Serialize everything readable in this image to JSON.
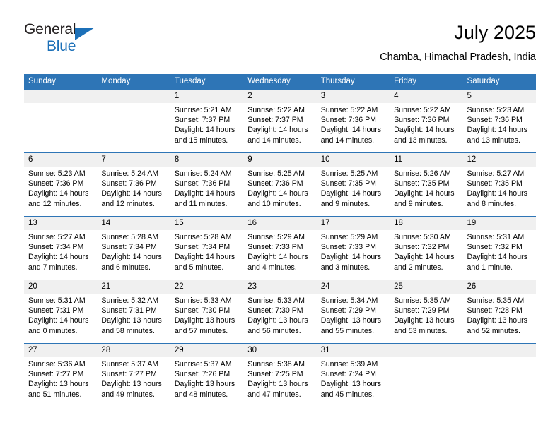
{
  "brand": {
    "name_top": "General",
    "name_bottom": "Blue",
    "accent_color": "#1c70b8"
  },
  "header": {
    "title": "July 2025",
    "location": "Chamba, Himachal Pradesh, India"
  },
  "theme": {
    "header_bg": "#2e75b6",
    "daynum_bg": "#f0f0f0",
    "cell_bg": "#ffffff",
    "text": "#000000"
  },
  "calendar": {
    "weekday_headers": [
      "Sunday",
      "Monday",
      "Tuesday",
      "Wednesday",
      "Thursday",
      "Friday",
      "Saturday"
    ],
    "weeks": [
      [
        {
          "day": "",
          "sunrise": "",
          "sunset": "",
          "daylight": "",
          "daylight2": ""
        },
        {
          "day": "",
          "sunrise": "",
          "sunset": "",
          "daylight": "",
          "daylight2": ""
        },
        {
          "day": "1",
          "sunrise": "Sunrise: 5:21 AM",
          "sunset": "Sunset: 7:37 PM",
          "daylight": "Daylight: 14 hours",
          "daylight2": "and 15 minutes."
        },
        {
          "day": "2",
          "sunrise": "Sunrise: 5:22 AM",
          "sunset": "Sunset: 7:37 PM",
          "daylight": "Daylight: 14 hours",
          "daylight2": "and 14 minutes."
        },
        {
          "day": "3",
          "sunrise": "Sunrise: 5:22 AM",
          "sunset": "Sunset: 7:36 PM",
          "daylight": "Daylight: 14 hours",
          "daylight2": "and 14 minutes."
        },
        {
          "day": "4",
          "sunrise": "Sunrise: 5:22 AM",
          "sunset": "Sunset: 7:36 PM",
          "daylight": "Daylight: 14 hours",
          "daylight2": "and 13 minutes."
        },
        {
          "day": "5",
          "sunrise": "Sunrise: 5:23 AM",
          "sunset": "Sunset: 7:36 PM",
          "daylight": "Daylight: 14 hours",
          "daylight2": "and 13 minutes."
        }
      ],
      [
        {
          "day": "6",
          "sunrise": "Sunrise: 5:23 AM",
          "sunset": "Sunset: 7:36 PM",
          "daylight": "Daylight: 14 hours",
          "daylight2": "and 12 minutes."
        },
        {
          "day": "7",
          "sunrise": "Sunrise: 5:24 AM",
          "sunset": "Sunset: 7:36 PM",
          "daylight": "Daylight: 14 hours",
          "daylight2": "and 12 minutes."
        },
        {
          "day": "8",
          "sunrise": "Sunrise: 5:24 AM",
          "sunset": "Sunset: 7:36 PM",
          "daylight": "Daylight: 14 hours",
          "daylight2": "and 11 minutes."
        },
        {
          "day": "9",
          "sunrise": "Sunrise: 5:25 AM",
          "sunset": "Sunset: 7:36 PM",
          "daylight": "Daylight: 14 hours",
          "daylight2": "and 10 minutes."
        },
        {
          "day": "10",
          "sunrise": "Sunrise: 5:25 AM",
          "sunset": "Sunset: 7:35 PM",
          "daylight": "Daylight: 14 hours",
          "daylight2": "and 9 minutes."
        },
        {
          "day": "11",
          "sunrise": "Sunrise: 5:26 AM",
          "sunset": "Sunset: 7:35 PM",
          "daylight": "Daylight: 14 hours",
          "daylight2": "and 9 minutes."
        },
        {
          "day": "12",
          "sunrise": "Sunrise: 5:27 AM",
          "sunset": "Sunset: 7:35 PM",
          "daylight": "Daylight: 14 hours",
          "daylight2": "and 8 minutes."
        }
      ],
      [
        {
          "day": "13",
          "sunrise": "Sunrise: 5:27 AM",
          "sunset": "Sunset: 7:34 PM",
          "daylight": "Daylight: 14 hours",
          "daylight2": "and 7 minutes."
        },
        {
          "day": "14",
          "sunrise": "Sunrise: 5:28 AM",
          "sunset": "Sunset: 7:34 PM",
          "daylight": "Daylight: 14 hours",
          "daylight2": "and 6 minutes."
        },
        {
          "day": "15",
          "sunrise": "Sunrise: 5:28 AM",
          "sunset": "Sunset: 7:34 PM",
          "daylight": "Daylight: 14 hours",
          "daylight2": "and 5 minutes."
        },
        {
          "day": "16",
          "sunrise": "Sunrise: 5:29 AM",
          "sunset": "Sunset: 7:33 PM",
          "daylight": "Daylight: 14 hours",
          "daylight2": "and 4 minutes."
        },
        {
          "day": "17",
          "sunrise": "Sunrise: 5:29 AM",
          "sunset": "Sunset: 7:33 PM",
          "daylight": "Daylight: 14 hours",
          "daylight2": "and 3 minutes."
        },
        {
          "day": "18",
          "sunrise": "Sunrise: 5:30 AM",
          "sunset": "Sunset: 7:32 PM",
          "daylight": "Daylight: 14 hours",
          "daylight2": "and 2 minutes."
        },
        {
          "day": "19",
          "sunrise": "Sunrise: 5:31 AM",
          "sunset": "Sunset: 7:32 PM",
          "daylight": "Daylight: 14 hours",
          "daylight2": "and 1 minute."
        }
      ],
      [
        {
          "day": "20",
          "sunrise": "Sunrise: 5:31 AM",
          "sunset": "Sunset: 7:31 PM",
          "daylight": "Daylight: 14 hours",
          "daylight2": "and 0 minutes."
        },
        {
          "day": "21",
          "sunrise": "Sunrise: 5:32 AM",
          "sunset": "Sunset: 7:31 PM",
          "daylight": "Daylight: 13 hours",
          "daylight2": "and 58 minutes."
        },
        {
          "day": "22",
          "sunrise": "Sunrise: 5:33 AM",
          "sunset": "Sunset: 7:30 PM",
          "daylight": "Daylight: 13 hours",
          "daylight2": "and 57 minutes."
        },
        {
          "day": "23",
          "sunrise": "Sunrise: 5:33 AM",
          "sunset": "Sunset: 7:30 PM",
          "daylight": "Daylight: 13 hours",
          "daylight2": "and 56 minutes."
        },
        {
          "day": "24",
          "sunrise": "Sunrise: 5:34 AM",
          "sunset": "Sunset: 7:29 PM",
          "daylight": "Daylight: 13 hours",
          "daylight2": "and 55 minutes."
        },
        {
          "day": "25",
          "sunrise": "Sunrise: 5:35 AM",
          "sunset": "Sunset: 7:29 PM",
          "daylight": "Daylight: 13 hours",
          "daylight2": "and 53 minutes."
        },
        {
          "day": "26",
          "sunrise": "Sunrise: 5:35 AM",
          "sunset": "Sunset: 7:28 PM",
          "daylight": "Daylight: 13 hours",
          "daylight2": "and 52 minutes."
        }
      ],
      [
        {
          "day": "27",
          "sunrise": "Sunrise: 5:36 AM",
          "sunset": "Sunset: 7:27 PM",
          "daylight": "Daylight: 13 hours",
          "daylight2": "and 51 minutes."
        },
        {
          "day": "28",
          "sunrise": "Sunrise: 5:37 AM",
          "sunset": "Sunset: 7:27 PM",
          "daylight": "Daylight: 13 hours",
          "daylight2": "and 49 minutes."
        },
        {
          "day": "29",
          "sunrise": "Sunrise: 5:37 AM",
          "sunset": "Sunset: 7:26 PM",
          "daylight": "Daylight: 13 hours",
          "daylight2": "and 48 minutes."
        },
        {
          "day": "30",
          "sunrise": "Sunrise: 5:38 AM",
          "sunset": "Sunset: 7:25 PM",
          "daylight": "Daylight: 13 hours",
          "daylight2": "and 47 minutes."
        },
        {
          "day": "31",
          "sunrise": "Sunrise: 5:39 AM",
          "sunset": "Sunset: 7:24 PM",
          "daylight": "Daylight: 13 hours",
          "daylight2": "and 45 minutes."
        },
        {
          "day": "",
          "sunrise": "",
          "sunset": "",
          "daylight": "",
          "daylight2": ""
        },
        {
          "day": "",
          "sunrise": "",
          "sunset": "",
          "daylight": "",
          "daylight2": ""
        }
      ]
    ]
  }
}
